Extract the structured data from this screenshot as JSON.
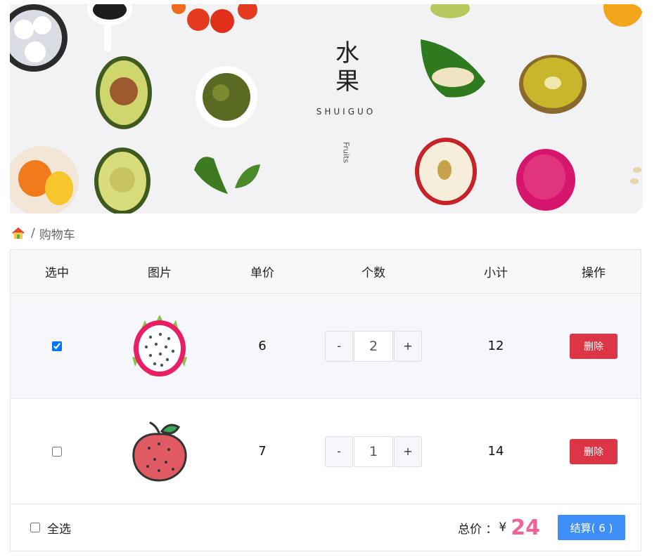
{
  "banner": {
    "title_line1": "水",
    "title_line2": "果",
    "subtitle": "SHUIGUO",
    "english": "Fruits"
  },
  "breadcrumb": {
    "home_icon": "house-icon",
    "separator": "/",
    "current": "购物车"
  },
  "table": {
    "headers": [
      "选中",
      "图片",
      "单价",
      "个数",
      "小计",
      "操作"
    ],
    "rows": [
      {
        "checked": true,
        "image": "dragon-fruit-icon",
        "price": "6",
        "qty": "2",
        "subtotal": "12",
        "delete_label": "删除",
        "minus": "-",
        "plus": "+"
      },
      {
        "checked": false,
        "image": "lychee-icon",
        "price": "7",
        "qty": "1",
        "subtotal": "14",
        "delete_label": "删除",
        "minus": "-",
        "plus": "+"
      }
    ]
  },
  "footer": {
    "select_all_label": "全选",
    "total_label": "总价 ：",
    "currency": "¥",
    "total_amount": "24",
    "checkout_label": "结算( 6 )"
  },
  "colors": {
    "delete": "#dc3545",
    "checkout": "#3e8ef7",
    "total_amount": "#f0649a"
  }
}
